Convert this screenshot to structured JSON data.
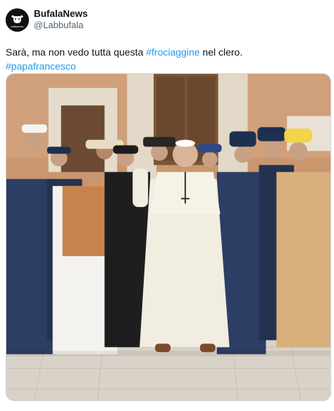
{
  "account": {
    "display_name": "BufalaNews",
    "handle": "@Labbufala",
    "avatar_icon": "buffalo-logo-icon",
    "avatar_caption": "bufalanews"
  },
  "tweet": {
    "text_before": "Sarà, ma non vedo tutta questa ",
    "hashtag_1": "#frociaggine",
    "text_after": " nel clero.",
    "hashtag_2": "#papafrancesco"
  },
  "media": {
    "alt": "Photo of the Pope in white cassock smiling among uniformed police officers, a sailor and costumed men in a courtyard"
  },
  "colors": {
    "link": "#1d9bf0",
    "text": "#0f1419",
    "secondary": "#536471",
    "wall": "#c9966e",
    "cassock": "#f1ede1",
    "uniform": "#2c3e63"
  }
}
